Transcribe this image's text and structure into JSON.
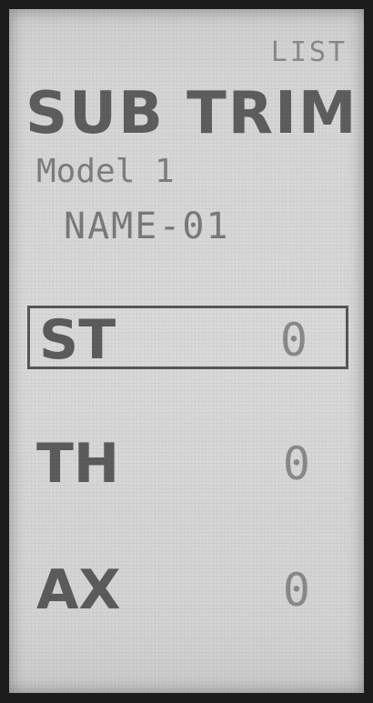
{
  "header": {
    "list_label": "LIST",
    "title": "SUB TRIM"
  },
  "model": {
    "label": "Model 1",
    "name": "NAME-01"
  },
  "channels": [
    {
      "name": "ST",
      "value": "0",
      "selected": true
    },
    {
      "name": "TH",
      "value": "0",
      "selected": false
    },
    {
      "name": "AX",
      "value": "0",
      "selected": false
    }
  ]
}
